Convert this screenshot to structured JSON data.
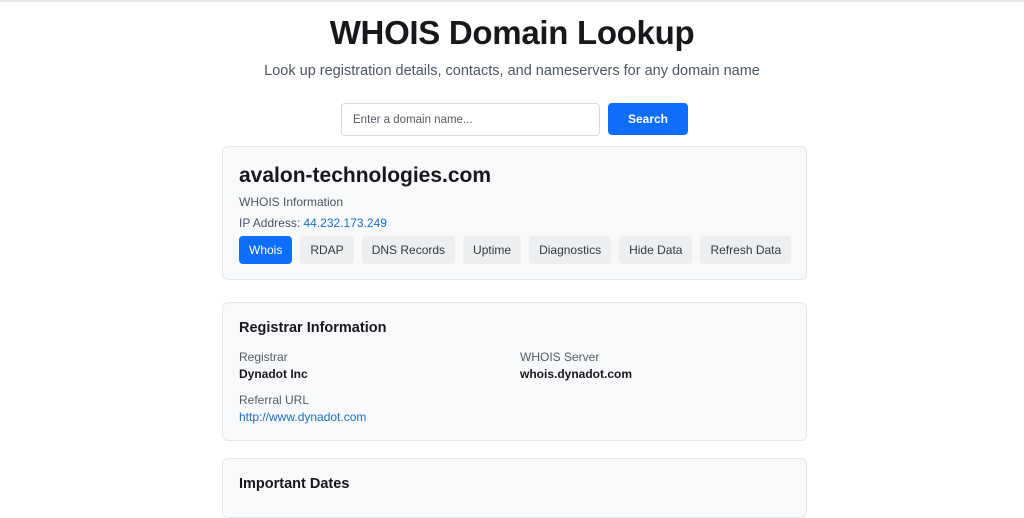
{
  "header": {
    "title": "WHOIS Domain Lookup",
    "subtitle": "Look up registration details, contacts, and nameservers for any domain name"
  },
  "search": {
    "placeholder": "Enter a domain name...",
    "button_label": "Search"
  },
  "domain": {
    "name": "avalon-technologies.com",
    "info_label": "WHOIS Information",
    "ip_label": "IP Address:",
    "ip_value": "44.232.173.249"
  },
  "tabs": [
    {
      "label": "Whois",
      "active": true
    },
    {
      "label": "RDAP",
      "active": false
    },
    {
      "label": "DNS Records",
      "active": false
    },
    {
      "label": "Uptime",
      "active": false
    },
    {
      "label": "Diagnostics",
      "active": false
    },
    {
      "label": "Hide Data",
      "active": false
    },
    {
      "label": "Refresh Data",
      "active": false
    }
  ],
  "registrar": {
    "section_title": "Registrar Information",
    "registrar_label": "Registrar",
    "registrar_value": "Dynadot Inc",
    "whois_server_label": "WHOIS Server",
    "whois_server_value": "whois.dynadot.com",
    "referral_label": "Referral URL",
    "referral_value": "http://www.dynadot.com"
  },
  "dates": {
    "section_title": "Important Dates"
  },
  "colors": {
    "accent": "#0d6efd",
    "link": "#1a6ec0"
  }
}
